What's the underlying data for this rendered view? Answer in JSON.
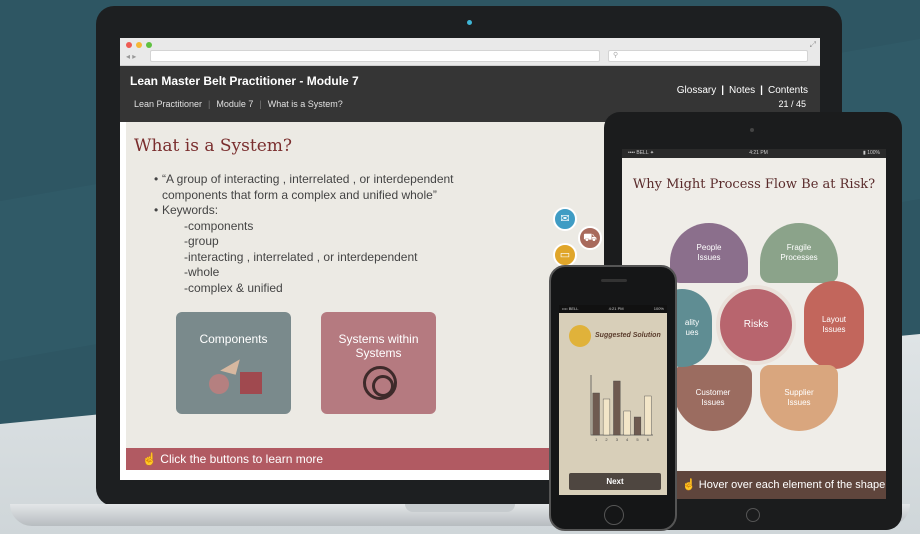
{
  "laptop": {
    "header": {
      "course_title": "Lean Master Belt Practitioner - Module 7",
      "breadcrumbs": [
        "Lean Practitioner",
        "Module 7",
        "What is a System?"
      ],
      "links": [
        "Glossary",
        "Notes",
        "Contents"
      ],
      "page": "21 / 45"
    },
    "slide": {
      "title": "What is a System?",
      "bullet1_line1": "“A group of interacting , interrelated , or interdependent",
      "bullet1_line2": "components that form a complex and unified whole”",
      "bullet2": "Keywords:",
      "keywords": [
        "-components",
        "-group",
        "-interacting , interrelated , or interdependent",
        "-whole",
        "-complex & unified"
      ],
      "card1": "Components",
      "card2_line1": "Systems within",
      "card2_line2": "Systems"
    },
    "click_bar": "Click the buttons to learn more",
    "progress_fraction": 0.89,
    "colors": {
      "accent": "#b15a62",
      "header": "#353535"
    }
  },
  "tablet": {
    "title": "Why Might Process Flow Be at Risk?",
    "center": "Risks",
    "petals": {
      "people": "People Issues",
      "fragile": "Fragile Processes",
      "layout": "Layout Issues",
      "supplier": "Supplier Issues",
      "customer": "Customer Issues",
      "quality": "ality ues"
    },
    "hover_bar": "Hover over each element of the shape"
  },
  "phone": {
    "title": "Suggested Solution",
    "button": "Next",
    "chart_data": {
      "type": "bar",
      "categories": [
        "1",
        "2",
        "3",
        "4",
        "5",
        "6"
      ],
      "values": [
        7,
        6,
        9,
        4,
        3,
        6.5
      ],
      "ylim": [
        0,
        10
      ]
    }
  }
}
